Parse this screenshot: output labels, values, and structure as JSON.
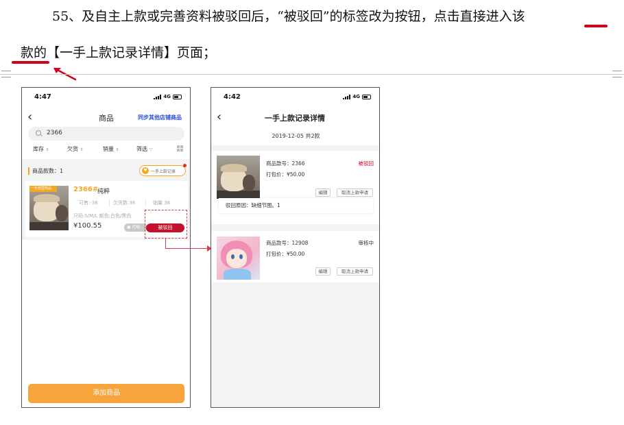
{
  "doc": {
    "line1": "55、及自主上款或完善资料被驳回后，“被驳回”的标签改为按钮，点击直接进入该",
    "line2": "款的【一手上款记录详情】页面；"
  },
  "phone_left": {
    "time": "4:47",
    "network": "4G",
    "title": "商品",
    "sync_link": "同步其他店铺商品",
    "search_value": "2366",
    "filters": [
      "库存",
      "欠货",
      "销量",
      "筛选"
    ],
    "count_label": "商品款数：1",
    "record_button": "一手上款记录",
    "product": {
      "tag": "一手自营商品",
      "code": "2366#",
      "name": "纯粹",
      "on_sale": "可售:-36",
      "owing": "欠货数:36",
      "sales": "销量:36",
      "attrs": "尺码:S/M/L   颜色:白色/黑色",
      "price": "¥100.55",
      "print_label": "打标",
      "rejected_label": "被驳回"
    },
    "add_button": "添加商品"
  },
  "phone_right": {
    "time": "4:42",
    "network": "4G",
    "title": "一手上款记录详情",
    "date_line": "2019-12-05 共2款",
    "items": [
      {
        "code": "商品款号：2366",
        "price": "打包价：¥50.00",
        "status": "被驳回",
        "edit": "编辑",
        "cancel": "取消上款申请",
        "reason": "驳回原因：缺细节图。1"
      },
      {
        "code": "商品款号：12908",
        "price": "打包价：¥50.00",
        "status": "审核中",
        "edit": "编辑",
        "cancel": "取消上款申请"
      }
    ]
  },
  "colors": {
    "accent_orange": "#f7a43d",
    "reject_red": "#c4112c",
    "link_blue": "#2b4fd6",
    "annotation_red": "#d0021b"
  }
}
